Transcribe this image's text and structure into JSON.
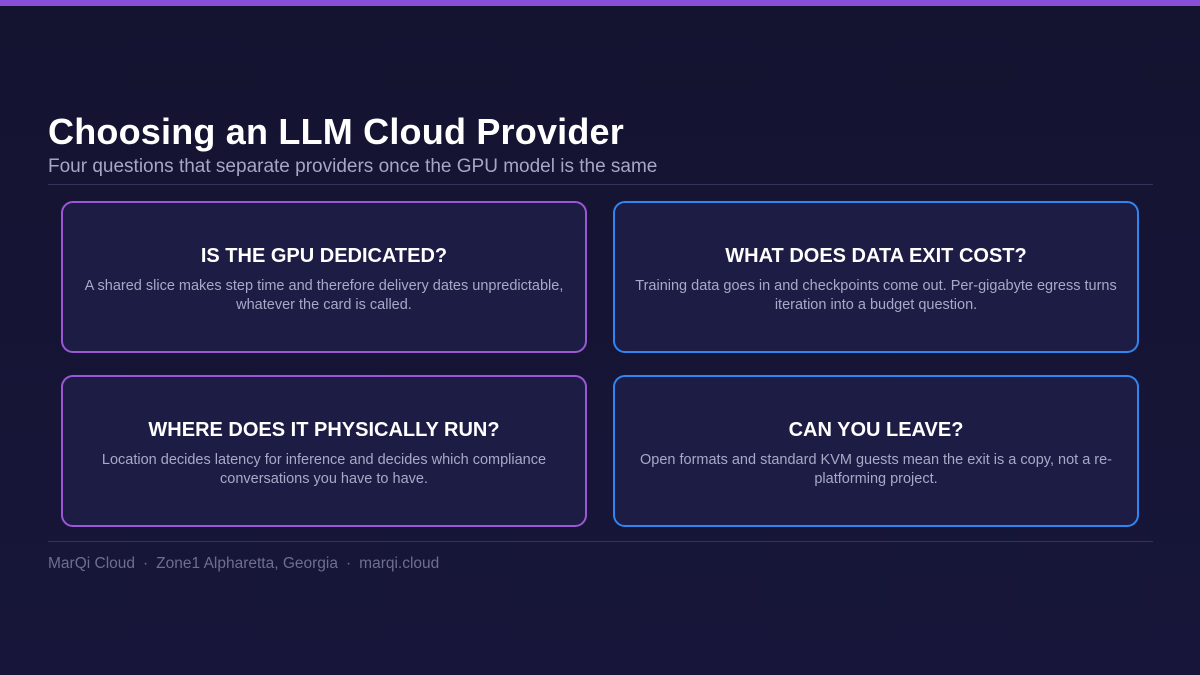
{
  "slide": {
    "title": "Choosing an LLM Cloud Provider",
    "subtitle": "Four questions that separate providers once the GPU model is the same",
    "accent_color": "#8a4fd8",
    "cards": [
      {
        "title": "IS THE GPU DEDICATED?",
        "body": "A shared slice makes step time and therefore delivery dates unpredictable, whatever the card is called.",
        "border_color": "#9a58d6"
      },
      {
        "title": "WHAT DOES DATA EXIT COST?",
        "body": "Training data goes in and checkpoints come out. Per-gigabyte egress turns iteration into a budget question.",
        "border_color": "#2f86f0"
      },
      {
        "title": "WHERE DOES IT PHYSICALLY RUN?",
        "body": "Location decides latency for inference and decides which compliance conversations you have to have.",
        "border_color": "#9a58d6"
      },
      {
        "title": "CAN YOU LEAVE?",
        "body": "Open formats and standard KVM guests mean the exit is a copy, not a re-platforming project.",
        "border_color": "#2f86f0"
      }
    ],
    "footer": {
      "brand": "MarQi Cloud",
      "location": "Zone1 Alpharetta, Georgia",
      "site": "marqi.cloud",
      "separator": "·"
    }
  }
}
